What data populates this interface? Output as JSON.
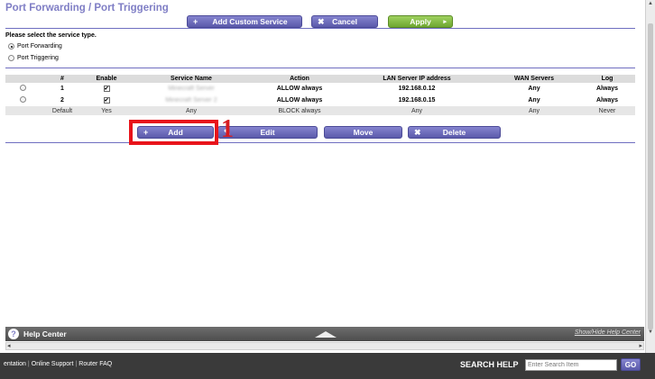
{
  "header": {
    "title": "Port Forwarding / Port Triggering"
  },
  "toolbar": {
    "add_custom_service": "Add Custom Service",
    "add_custom_icon": "+",
    "cancel": "Cancel",
    "cancel_icon": "✖",
    "apply": "Apply",
    "apply_icon": "▸"
  },
  "service_type": {
    "prompt": "Please select the service type.",
    "options": [
      {
        "label": "Port Forwarding",
        "selected": true
      },
      {
        "label": "Port Triggering",
        "selected": false
      }
    ]
  },
  "table": {
    "columns": [
      "#",
      "Enable",
      "Service Name",
      "Action",
      "LAN Server IP address",
      "WAN Servers",
      "Log"
    ],
    "rows": [
      {
        "num": "1",
        "enabled": "✔",
        "service_name": "Minecraft Server",
        "action": "ALLOW always",
        "lan_ip": "192.168.0.12",
        "wan": "Any",
        "log": "Always"
      },
      {
        "num": "2",
        "enabled": "✔",
        "service_name": "Minecraft Server 2",
        "action": "ALLOW always",
        "lan_ip": "192.168.0.15",
        "wan": "Any",
        "log": "Always"
      }
    ],
    "default_row": {
      "num": "Default",
      "enabled": "Yes",
      "service_name": "Any",
      "action": "BLOCK always",
      "lan_ip": "Any",
      "wan": "Any",
      "log": "Never"
    }
  },
  "row_actions": {
    "add": "Add",
    "add_icon": "+",
    "edit": "Edit",
    "edit_icon": "✎",
    "move": "Move",
    "delete": "Delete",
    "delete_icon": "✖"
  },
  "annotation": {
    "callout_number": "1",
    "highlight_color": "#e8141b"
  },
  "help_center": {
    "label": "Help Center",
    "icon": "?",
    "toggle": "Show/Hide Help Center"
  },
  "footer": {
    "links": [
      "entation",
      "Online Support",
      "Router FAQ"
    ],
    "search_label": "SEARCH HELP",
    "search_placeholder": "Enter Search Item",
    "go": "GO"
  },
  "colors": {
    "accent": "#7f7ec5",
    "button": "#6b6abb",
    "apply": "#8cc34a",
    "footer": "#3a3a3a"
  }
}
